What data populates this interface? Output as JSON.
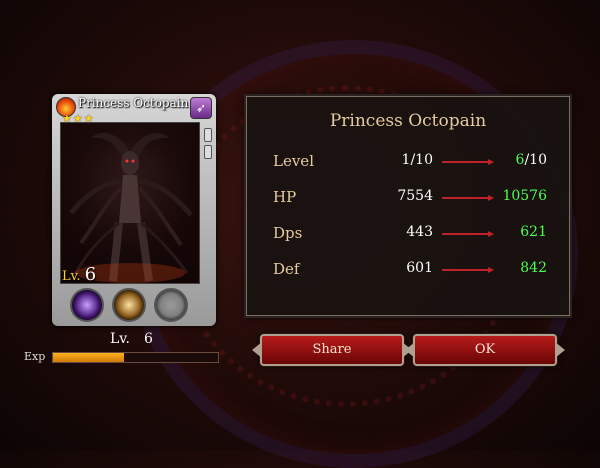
{
  "card": {
    "name": "Princess Octopain",
    "stars": "★★★",
    "level_prefix": "Lv.",
    "level_value": "6"
  },
  "level_display": {
    "label": "Lv.",
    "value": "6"
  },
  "exp": {
    "label": "Exp",
    "progress": 0.43
  },
  "panel": {
    "title": "Princess Octopain",
    "stats": [
      {
        "label": "Level",
        "old": "1/10",
        "new": "6",
        "new_suffix": "/10"
      },
      {
        "label": "HP",
        "old": "7554",
        "new": "10576",
        "new_suffix": ""
      },
      {
        "label": "Dps",
        "old": "443",
        "new": "621",
        "new_suffix": ""
      },
      {
        "label": "Def",
        "old": "601",
        "new": "842",
        "new_suffix": ""
      }
    ]
  },
  "buttons": {
    "share": "Share",
    "ok": "OK"
  },
  "colors": {
    "increase": "#4cff4c",
    "accent": "#e7caa0",
    "button": "#9a0f0f"
  }
}
